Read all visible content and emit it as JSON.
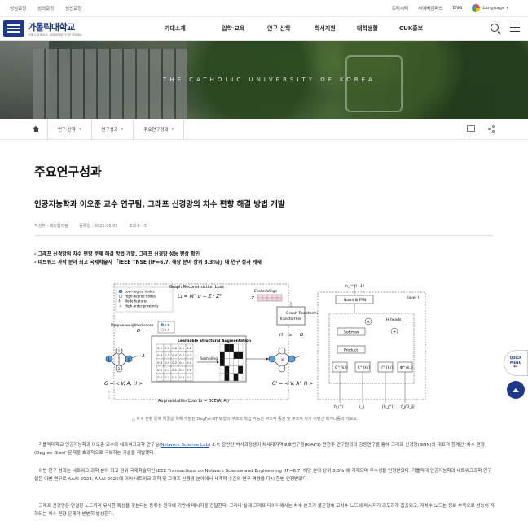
{
  "utility_bar": {
    "left_links": [
      "성심교정",
      "성의교정",
      "성신교정"
    ],
    "right_links": [
      "트리시티",
      "사이버캠퍼스",
      "ENG"
    ],
    "language_label": "Language"
  },
  "header": {
    "logo_ko": "가톨릭대학교",
    "logo_en": "THE CATHOLIC UNIVERSITY OF KOREA",
    "nav": [
      "가대소개",
      "입학·교육",
      "연구·산학",
      "학사지원",
      "대학생활",
      "CUK홍보"
    ],
    "icons": [
      "search-icon",
      "menu-icon"
    ]
  },
  "banner": {
    "text": "THE CATHOLIC UNIVERSITY OF KOREA"
  },
  "breadcrumb": {
    "items": [
      "연구·산학",
      "연구성과",
      "주요연구성과"
    ],
    "icons": [
      "home-icon",
      "print-icon",
      "share-icon"
    ]
  },
  "page_title": "주요연구성과",
  "article": {
    "title": "인공지능학과 이오준 교수 연구팀, 그래프 신경망의 차수 편향 해결 방법 개발",
    "meta": {
      "author": "작성자 : 대외협력팀",
      "date": "등록일 : 2025.05.07",
      "views": "조회수 : 5"
    },
    "bullets": [
      "- 그래프 신경망의 차수 편향 문제 해결 방법 개발, 그래프 신경망 성능 향상 확인",
      "- 네트워크 과학 분야 최고 국제학술지 「IEEE TNSE (IF=6.7, 해당 분야 상위 3.3%)」에 연구 성과 게재"
    ],
    "figure": {
      "legend": [
        "Low-degree nodes",
        "High-degree nodes",
        "Node features",
        "High-order proximity"
      ],
      "labels": {
        "graph_recon_loss": "Graph Reconstruction Loss",
        "recon_eq": "L₁ = M^σ − Z · Zᵀ",
        "embeddings": "Embeddings",
        "z": "Z",
        "degree_weighted": "Degree-weighted score",
        "d": "D",
        "lsa": "Learnable Structural Augmentation",
        "sampling": "Sampling",
        "graph_transformer": "Graph Transformer",
        "h": "H",
        "a": "A",
        "g_left": "G = < V, A, H >",
        "g_right": "G' = < V, A', H >",
        "aug_loss": "Augmentation Loss L₂ = BCE(A, A')",
        "layer": "layer l",
        "norm_ffn": "Norm & FFN",
        "softmax": "Softmax",
        "product": "Product",
        "heads": "H heads",
        "h_out": "h_i^{l+1}",
        "q": "Q^{k,l}",
        "k": "K^{k,l}",
        "v": "V^{k,l}",
        "phi": "Φ^{k,l}",
        "b_h": "h_i^l",
        "b_s": "s_ij",
        "b_hj": "{h_j^l}",
        "b_f": "f_j(D_ij)"
      },
      "matrix": [
        [
          "0.1",
          "0.9",
          "0.8",
          "0.2",
          "0.2"
        ],
        [
          "0.9",
          "0.2",
          "0.4",
          "0.7",
          "0.7"
        ],
        [
          "0.8",
          "0.4",
          "0.2",
          "0.1",
          "0.1"
        ],
        [
          "0.2",
          "0.7",
          "0.1",
          "0.1",
          "0.9"
        ],
        [
          "0.2",
          "0.7",
          "0.1",
          "0.9",
          "0.1"
        ]
      ],
      "mini_values": [
        "0.4",
        "0.1"
      ]
    },
    "caption": "△ 차수 편향 문제 해결을 위해 개발된 DegFairGT 모형의 구조와 학습 가능한 구조적 증강 및 구조적 자기 어텐션 메커니즘의 개요도",
    "paragraphs": [
      {
        "pre": "가톨릭대학교 인공지능학과 이오준 교수와 네트워크과학 연구실(",
        "link": "Network Science Lab",
        "post": ") 소속 응반탄 박사과정생이 차세대지역보호연구원(KIAPS) 전현주 연구원과의 공동연구를 통해 그래프 신경망(GNN)의 대표적 한계인 '차수 편향(Degree Bias)' 문제를 효과적으로 극복하는 기술을 개발했다."
      },
      {
        "text": "이번 연구 성과는 네트워크 과학 분야 최고 권위 국제학술지인 IEEE Transactions on Network Science and Engineering (IF=6.7, 해당 분야 상위 3.3%)에 게재되며 우수성을 인정받았다. 가톨릭대 인공지능학과 네트워크과학 연구실은 이번 연구로 AAAI 2024, AAAI 2025에 이어 네트워크 과학 및 그래프 신경망 분야에서 세계적 수준의 연구 역량을 다시 한번 인정받았다."
      },
      {
        "text": "그래프 신경망은 연결된 노드끼리 유사한 특성을 갖는다는 동류성 원칙에 기반해 메시지를 전달한다. 그러나 실제 그래프 데이터에서는 차수 분포가 불균형해 고차수 노드에 메시지가 과도하게 집중되고, 저차수 노드는 정보 부족으로 성능이 저하되는 차수 편향 문제가 빈번히 발생한다."
      }
    ]
  },
  "floating": {
    "quick_menu": "QUICK MENU",
    "top": "top"
  },
  "colors": {
    "brand_blue": "#1d3a8a",
    "link_blue": "#1a56b5"
  }
}
